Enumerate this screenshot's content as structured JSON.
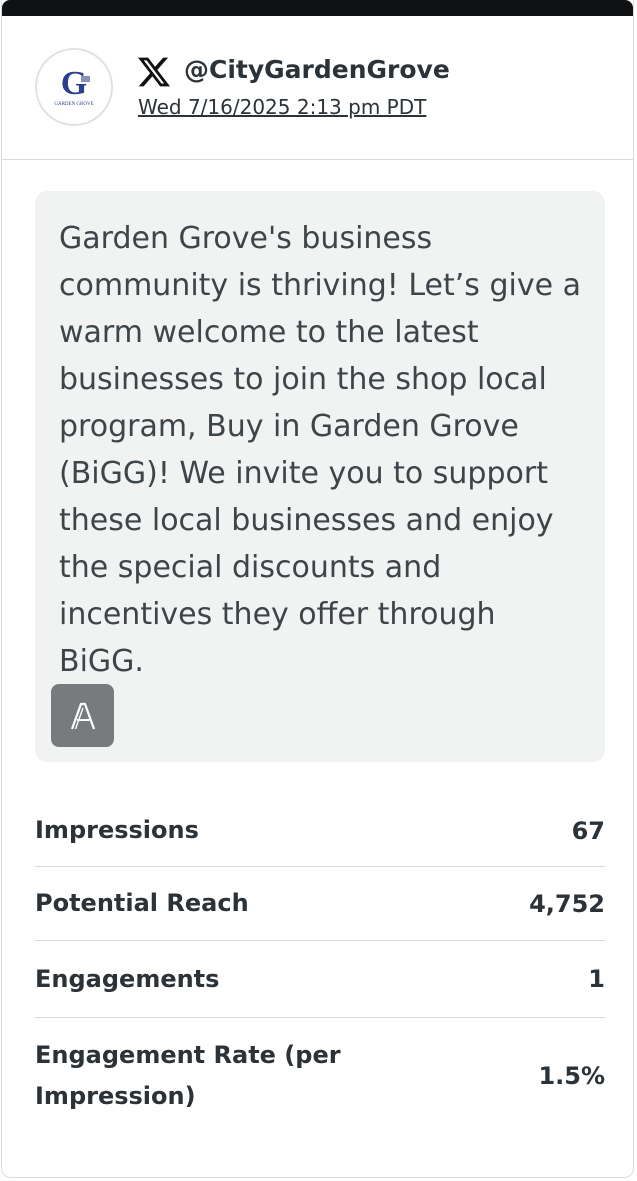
{
  "post": {
    "network_icon": "x-logo-icon",
    "handle": "@CityGardenGrove",
    "timestamp": "Wed 7/16/2025 2:13 pm PDT",
    "avatar": {
      "icon": "garden-grove-logo",
      "lettering": "G",
      "sublettering": "GARDEN GROVE"
    },
    "message": "Garden Grove's business community is thriving! Let’s give a warm welcome to the latest businesses to join the shop local program, Buy in Garden Grove (BiGG)! We invite you to support these local businesses and enjoy the special discounts and incentives they offer through BiGG.",
    "translate_icon": "translate-icon"
  },
  "metrics": [
    {
      "label": "Impressions",
      "value": "67"
    },
    {
      "label": "Potential Reach",
      "value": "4,752"
    },
    {
      "label": "Engagements",
      "value": "1"
    },
    {
      "label": "Engagement Rate (per Impression)",
      "value": "1.5%"
    }
  ],
  "colors": {
    "top_bar": "#0f1112",
    "text": "#2b3238",
    "message_bg": "#f1f3f3",
    "divider": "#d9dcdf",
    "translate_button": "#777b7d",
    "logo_blue": "#2c3e8f"
  }
}
